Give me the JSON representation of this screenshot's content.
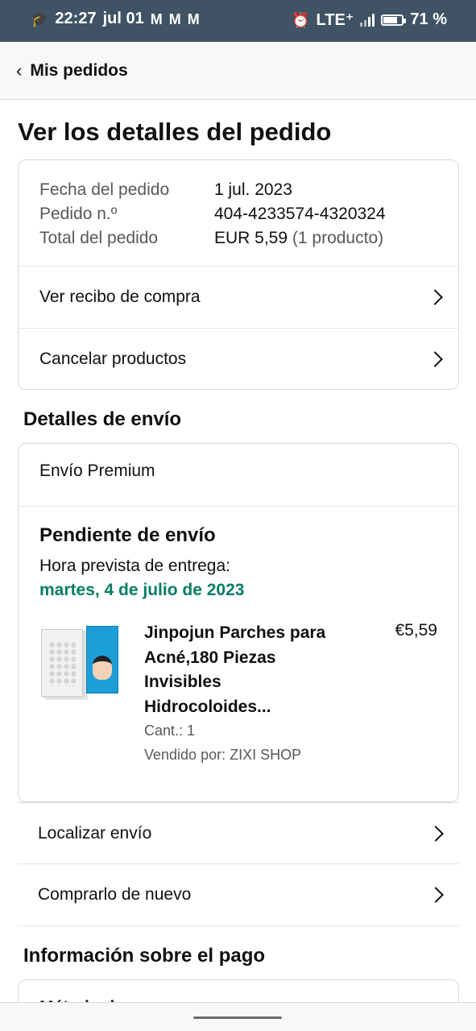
{
  "status_bar": {
    "time": "22:27",
    "date": "jul 01",
    "network": "LTE⁺",
    "battery_percent_text": "71 %",
    "battery_level": 0.71,
    "icons": [
      "graduation-cap-icon",
      "gmail-icon",
      "gmail-icon",
      "gmail-icon",
      "alarm-icon",
      "signal-icon",
      "battery-icon"
    ]
  },
  "nav": {
    "back_label": "Mis pedidos"
  },
  "page": {
    "title": "Ver los detalles del pedido"
  },
  "order_summary": {
    "rows": [
      {
        "label": "Fecha del pedido",
        "value": "1 jul. 2023",
        "extra": ""
      },
      {
        "label": "Pedido n.º",
        "value": "404-4233574-4320324",
        "extra": ""
      },
      {
        "label": "Total del pedido",
        "value": "EUR 5,59",
        "extra": "(1 producto)"
      }
    ],
    "links": [
      "Ver recibo de compra",
      "Cancelar productos"
    ]
  },
  "shipping": {
    "section_title": "Detalles de envío",
    "method": "Envío Premium",
    "status": "Pendiente de envío",
    "eta_label": "Hora prevista de entrega:",
    "eta_date": "martes, 4 de julio de 2023",
    "eta_color": "#067d62",
    "item": {
      "name": "Jinpojun Parches para Acné,180 Piezas Invisibles Hidrocoloides...",
      "price": "€5,59",
      "quantity": "Cant.: 1",
      "seller": "Vendido por: ZIXI SHOP"
    },
    "links": [
      "Localizar envío",
      "Comprarlo de nuevo"
    ]
  },
  "payment": {
    "section_title": "Información sobre el pago",
    "partial_text": "Método de pago"
  }
}
